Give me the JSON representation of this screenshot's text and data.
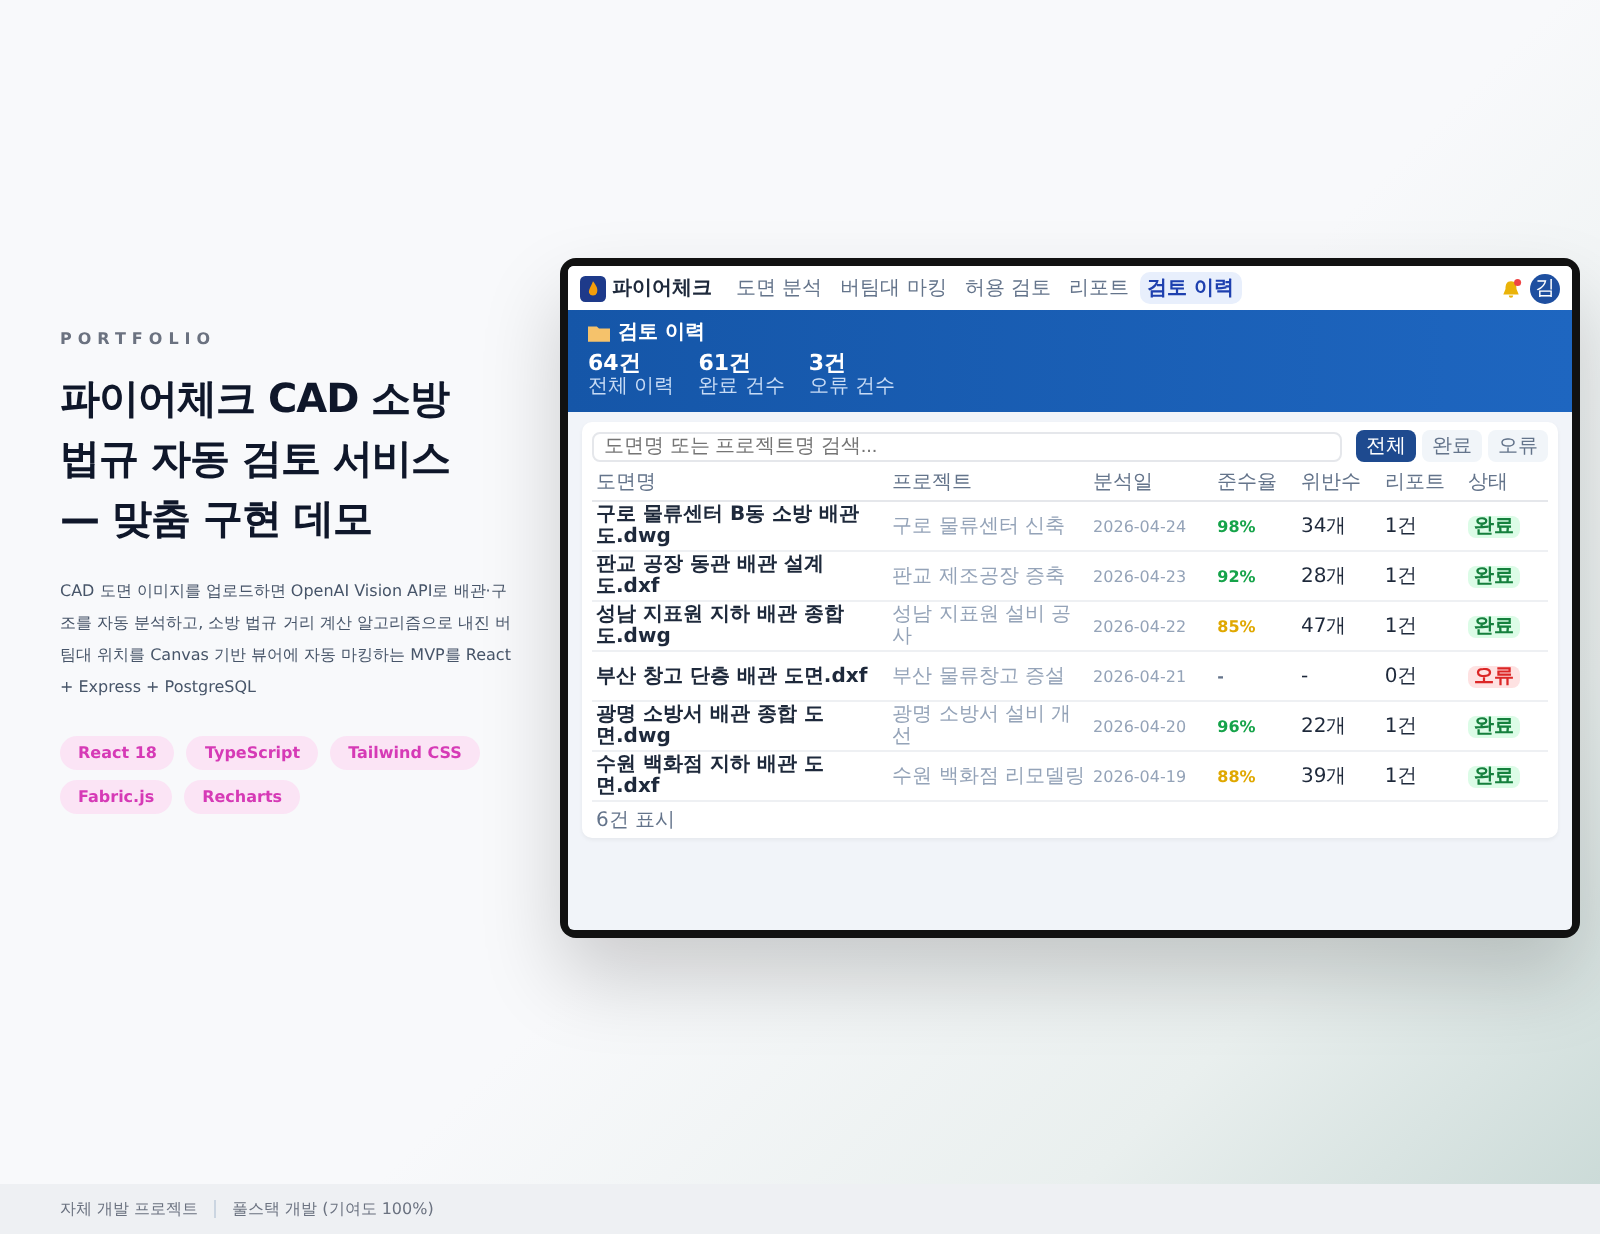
{
  "hero": {
    "eyebrow": "PORTFOLIO",
    "title_lines": [
      "파이어체크 CAD 소방",
      "법규 자동 검토 서비스",
      "— 맞춤 구현 데모"
    ],
    "description": "CAD 도면 이미지를 업로드하면 OpenAI Vision API로 배관·구조를 자동 분석하고, 소방 법규 거리 계산 알고리즘으로 내진 버팀대 위치를 Canvas 기반 뷰어에 자동 마킹하는 MVP를 React + Express + PostgreSQL",
    "tags": [
      "React 18",
      "TypeScript",
      "Tailwind CSS",
      "Fabric.js",
      "Recharts"
    ]
  },
  "app": {
    "logo": "파이어체크",
    "nav": [
      {
        "label": "도면 분석",
        "selected": false
      },
      {
        "label": "버팀대 마킹",
        "selected": false
      },
      {
        "label": "허용 검토",
        "selected": false
      },
      {
        "label": "리포트",
        "selected": false
      },
      {
        "label": "검토 이력",
        "selected": true
      }
    ],
    "notification": true,
    "avatar": "김",
    "header": {
      "title": "검토 이력",
      "stats": [
        {
          "value": "64건",
          "label": "전체 이력"
        },
        {
          "value": "61건",
          "label": "완료 건수"
        },
        {
          "value": "3건",
          "label": "오류 건수"
        }
      ]
    },
    "search": {
      "placeholder": "도면명 또는 프로젝트명 검색..."
    },
    "filters": [
      {
        "label": "전체",
        "selected": true
      },
      {
        "label": "완료",
        "selected": false
      },
      {
        "label": "오류",
        "selected": false
      }
    ],
    "table": {
      "columns": [
        "도면명",
        "프로젝트",
        "분석일",
        "준수율",
        "위반수",
        "리포트",
        "상태"
      ],
      "rows": [
        {
          "file": "구로 물류센터 B동 소방 배관도.dwg",
          "project": "구로 물류센터 신축",
          "date": "2026-04-24",
          "rate": "98%",
          "color": "#16a34a",
          "violations": "34개",
          "reports": "1건",
          "status": "완료",
          "error": false
        },
        {
          "file": "판교 공장 동관 배관 설계도.dxf",
          "project": "판교 제조공장 증축",
          "date": "2026-04-23",
          "rate": "92%",
          "color": "#16a34a",
          "violations": "28개",
          "reports": "1건",
          "status": "완료",
          "error": false
        },
        {
          "file": "성남 지표원 지하 배관 종합도.dwg",
          "project": "성남 지표원 설비 공사",
          "date": "2026-04-22",
          "rate": "85%",
          "color": "#e0a800",
          "violations": "47개",
          "reports": "1건",
          "status": "완료",
          "error": false
        },
        {
          "file": "부산 창고 단층 배관 도면.dxf",
          "project": "부산 물류창고 증설",
          "date": "2026-04-21",
          "rate": "-",
          "color": "#64748b",
          "violations": "-",
          "reports": "0건",
          "status": "오류",
          "error": true
        },
        {
          "file": "광명 소방서 배관 종합 도면.dwg",
          "project": "광명 소방서 설비 개선",
          "date": "2026-04-20",
          "rate": "96%",
          "color": "#16a34a",
          "violations": "22개",
          "reports": "1건",
          "status": "완료",
          "error": false
        },
        {
          "file": "수원 백화점 지하 배관 도면.dxf",
          "project": "수원 백화점 리모델링",
          "date": "2026-04-19",
          "rate": "88%",
          "color": "#e0a800",
          "violations": "39개",
          "reports": "1건",
          "status": "완료",
          "error": false
        }
      ]
    },
    "footer": "6건 표시"
  },
  "footer": [
    "자체 개발 프로젝트",
    "풀스택 개발 (기여도 100%)"
  ]
}
